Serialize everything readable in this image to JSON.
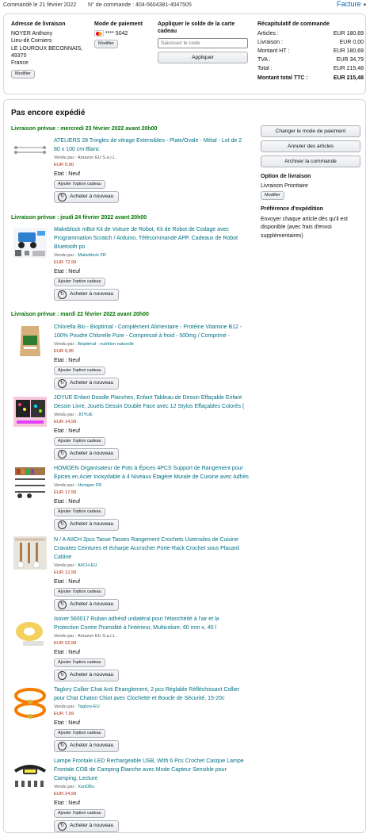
{
  "header": {
    "ordered_on": "Commandé le 21 février 2022",
    "order_number": "N° de commande : 404-5604381-4047505",
    "invoice": "Facture"
  },
  "summary": {
    "address_title": "Adresse de livraison",
    "address_lines": [
      "NOYER Anthony",
      "Lieu-dit Corniers",
      "LE LOUROUX BECONNAIS,",
      "49370",
      "France"
    ],
    "address_edit": "Modifier",
    "payment_title": "Mode de paiement",
    "card_digits": "**** 5042",
    "payment_edit": "Modifier",
    "gift_title": "Appliquer le solde de la carte cadeau",
    "gift_placeholder": "Saisissez le code",
    "gift_apply": "Appliquer",
    "recap_title": "Récapitulatif de commande",
    "recap_rows": [
      {
        "label": "Articles :",
        "value": "EUR 180,69"
      },
      {
        "label": "Livraison :",
        "value": "EUR 0,00"
      },
      {
        "label": "Montant HT :",
        "value": "EUR 180,69"
      },
      {
        "label": "TVA :",
        "value": "EUR 34,79"
      },
      {
        "label": "Total :",
        "value": "EUR 215,48"
      }
    ],
    "recap_total_label": "Montant total TTC :",
    "recap_total_value": "EUR 215,48"
  },
  "shipment": {
    "title": "Pas encore expédié",
    "actions": [
      "Changer le mode de paiement",
      "Annuler des articles",
      "Archiver la commande"
    ],
    "option_title": "Option de livraison",
    "option_value": "Livraison Prioritaire",
    "option_edit": "Modifier",
    "pref_title": "Préférence d'expédition",
    "pref_text": [
      "Envoyer chaque article dès qu'il est",
      "disponible (avec frais d'envoi",
      "supplémentaires)"
    ],
    "gift_option_label": "Ajouter l'option cadeau",
    "rebuy_label": "Acheter à nouveau",
    "sold_by_label": "Vendu par :",
    "etat_label": "Etat :",
    "condition": "Neuf",
    "groups": [
      {
        "delivery_prefix": "Livraison prévue : ",
        "delivery_date": "mercredi 23 février 2022 avant 20h00",
        "items": [
          {
            "title": [
              "ATELIERS 28 Tringles de vitrage Extensibles - Plate/Ovale - Métal - Lot de 2",
              "80 x 100 cm Blanc"
            ],
            "seller": "Amazon EU S.a.r.L.",
            "price": "EUR 9,90"
          }
        ]
      },
      {
        "delivery_prefix": "Livraison prévue : ",
        "delivery_date": "jeudi 24 février 2022 avant 20h00",
        "items": [
          {
            "title": [
              "Makeblock mBot Kit de Voiture de Robot, Kit de Robot de Codage avec",
              "Programmation Scratch / Arduino, Télécommande APP, Cadeaux de Robot",
              "Bluetooth po"
            ],
            "seller": "Makeblock FR",
            "price": "EUR 72,99"
          }
        ]
      },
      {
        "delivery_prefix": "Livraison prévue : ",
        "delivery_date": "mardi 22 février 2022 avant 20h00",
        "items": [
          {
            "title": [
              "Chlorella Bio - Bioptimal - Complément Alimentaire - Protéine Vitamine B12 -",
              "100% Poudre Chlorelle Pure - Compressé à froid - 500mg / Comprimé -"
            ],
            "seller": "Bioptimal - nutrition naturelle",
            "price": "EUR 9,95"
          },
          {
            "title": [
              "JOYUE Enfant Doodle Planches, Enfant Tableau de Dessin Effaçable Enfant",
              "Dessin Livre, Jouets Dessin Double Face avec 12 Stylos Effaçables Colorés ("
            ],
            "seller": "JOYUE",
            "price": "EUR 14,99"
          },
          {
            "title": [
              "HOMGEN Organisateur de Pots à Épices 4PCS Support de Rangement pour",
              "Épices en Acier Inoxydable à 4 Niveaux Étagère Murale de Cuisine avec Adhés"
            ],
            "seller": "Homgen FR",
            "price": "EUR 17,99"
          },
          {
            "title": [
              "N / A AIICH 2pcs Tasse Tasses Rangement Crochets Ustensiles de Cuisine",
              "Cravates Ceintures et écharpe Accrocher Porte-Rack Crochet sous Placard",
              "Cabine"
            ],
            "seller": "AIICH-EU",
            "price": "EUR 12,99"
          },
          {
            "title": [
              "Isover 560017 Ruban adhésif unilatéral pour l'étanchéité à l'air et la",
              "Protection Contre l'humidité à l'intérieur, Multicolore, 60 mm x, 40 l"
            ],
            "seller": "Amazon EU S.a.r.L.",
            "price": "EUR 22,99"
          },
          {
            "title": [
              "Taglory Collier Chat Anti Étranglement, 2 pcs Réglable Réfléchissant Collier",
              "pour Chat Chaton Chiot avec Clochette et Boucle de Sécurité, 15-20c"
            ],
            "seller": "Taglory-EU",
            "price": "EUR 7,99"
          },
          {
            "title": [
              "Lampe Frontale LED Rechargeable USB, With 6 Pcs Crochet Casque Lampe",
              "Frontale COB de Camping Étanche avec Mode Capteur Sensible pour",
              "Camping, Lecture"
            ],
            "seller": "XunDBu",
            "price": "EUR 24,99"
          }
        ]
      }
    ]
  },
  "colors": {
    "link": "#007185",
    "delivery": "#007600",
    "price": "#b12704",
    "accent": "#0066c0"
  },
  "icons": [
    "rebuy-icon",
    "card-icon",
    "caret-down-icon"
  ]
}
